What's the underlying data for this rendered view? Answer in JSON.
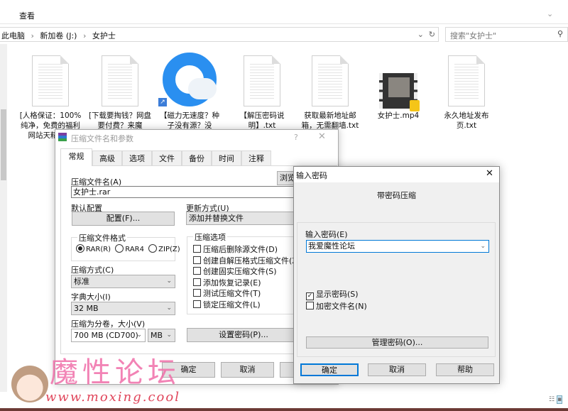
{
  "explorer": {
    "ribbon_tab": "查看",
    "breadcrumb": [
      "此电脑",
      "新加卷 (J:)",
      "女护士"
    ],
    "search_placeholder": "搜索\"女护士\"",
    "files": [
      {
        "name": "[人格保证：100%纯净，免费的福利网站天精选发",
        "icon": "text-file-icon"
      },
      {
        "name": "[下载要掏钱？网盘要付费？来魔",
        "icon": "text-file-icon"
      },
      {
        "name": "【磁力无速度？种子没有源？没",
        "icon": "qq-browser-shortcut-icon"
      },
      {
        "name": "【解压密码说明】.txt",
        "icon": "text-file-icon"
      },
      {
        "name": "获取最新地址邮箱，无需翻墙.txt",
        "icon": "text-file-icon"
      },
      {
        "name": "女护士.mp4",
        "icon": "video-file-icon"
      },
      {
        "name": "永久地址发布页.txt",
        "icon": "text-file-icon"
      }
    ]
  },
  "winrar": {
    "title": "压缩文件名和参数",
    "help": "?",
    "tabs": [
      "常规",
      "高级",
      "选项",
      "文件",
      "备份",
      "时间",
      "注释"
    ],
    "active_tab": "常规",
    "archive_name_label": "压缩文件名(A)",
    "archive_name": "女护士.rar",
    "browse": "浏览",
    "profile_label": "默认配置",
    "profile_button": "配置(F)...",
    "update_label": "更新方式(U)",
    "update_value": "添加并替换文件",
    "format_label": "压缩文件格式",
    "formats": [
      "RAR(R)",
      "RAR4",
      "ZIP(Z)"
    ],
    "format_selected": "RAR(R)",
    "method_label": "压缩方式(C)",
    "method_value": "标准",
    "dict_label": "字典大小(I)",
    "dict_value": "32 MB",
    "volume_label": "压缩为分卷，大小(V)",
    "volume_value": "700 MB  (CD700)",
    "volume_unit": "MB",
    "options_label": "压缩选项",
    "options": [
      {
        "label": "压缩后删除源文件(D)",
        "checked": false
      },
      {
        "label": "创建自解压格式压缩文件(X)",
        "checked": false
      },
      {
        "label": "创建固实压缩文件(S)",
        "checked": false
      },
      {
        "label": "添加恢复记录(E)",
        "checked": false
      },
      {
        "label": "测试压缩文件(T)",
        "checked": false
      },
      {
        "label": "锁定压缩文件(L)",
        "checked": false
      }
    ],
    "set_password": "设置密码(P)...",
    "ok": "确定",
    "cancel": "取消"
  },
  "password_dialog": {
    "title": "输入密码",
    "heading": "带密码压缩",
    "password_label": "输入密码(E)",
    "password_value": "我爱魔性论坛",
    "show_password": {
      "label": "显示密码(S)",
      "checked": true
    },
    "encrypt_names": {
      "label": "加密文件名(N)",
      "checked": false
    },
    "manage": "管理密码(O)...",
    "ok": "确定",
    "cancel": "取消",
    "help": "帮助"
  },
  "watermark": {
    "title": "魔性论坛",
    "url": "www.moxing.cool"
  },
  "colors": {
    "accent": "#0078d7",
    "watermark_pink": "#f06ea9",
    "watermark_red": "#e0455a"
  }
}
